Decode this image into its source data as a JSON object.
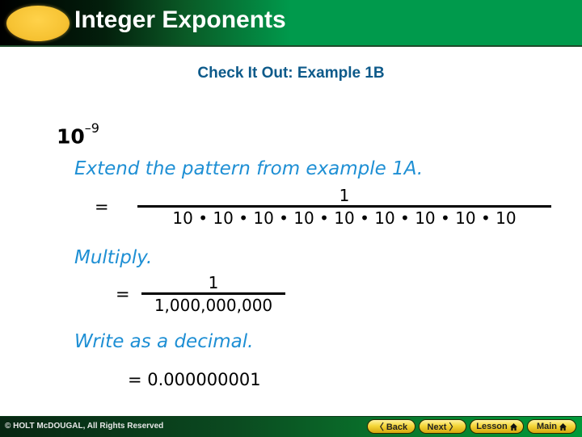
{
  "header": {
    "title": "Integer Exponents"
  },
  "subtitle": "Check It Out: Example 1B",
  "expression": {
    "base": "10",
    "exponent": "–9"
  },
  "steps": [
    {
      "label": "Extend the pattern from example 1A.",
      "equals": "=",
      "numerator": "1",
      "denominator": "10 • 10 • 10 • 10 • 10 • 10 • 10 • 10 • 10"
    },
    {
      "label": "Multiply.",
      "equals": "=",
      "numerator": "1",
      "denominator": "1,000,000,000"
    },
    {
      "label": "Write as a decimal.",
      "result": "= 0.000000001"
    }
  ],
  "footer": {
    "copyright": "© HOLT McDOUGAL, All Rights Reserved",
    "buttons": {
      "back": "〈 Back",
      "next": "Next 〉",
      "lesson": "Lesson",
      "main": "Main"
    }
  }
}
